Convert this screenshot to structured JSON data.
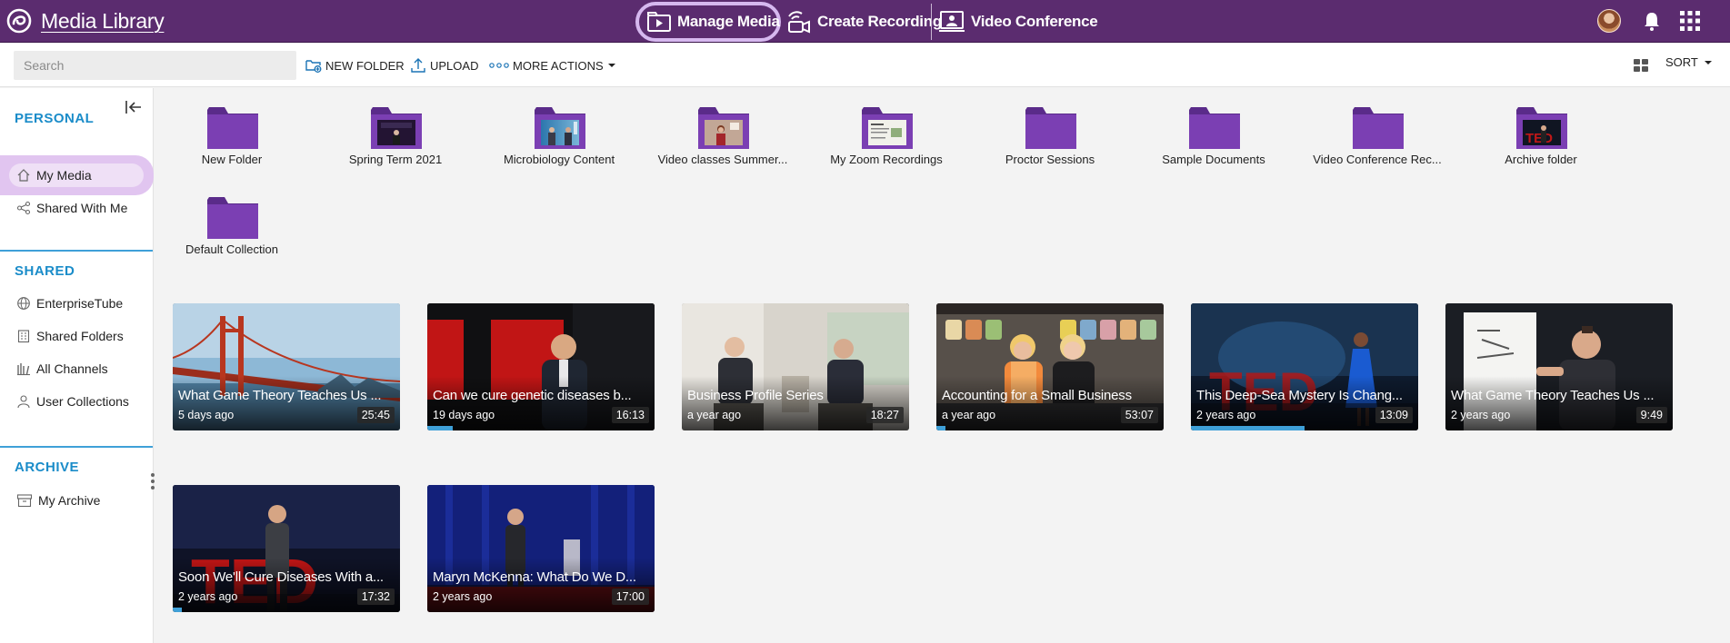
{
  "app": {
    "title": "Media Library"
  },
  "nav": {
    "manage_media": "Manage Media",
    "create_recording": "Create Recording",
    "video_conference": "Video Conference"
  },
  "toolbar": {
    "search_placeholder": "Search",
    "new_folder": "NEW FOLDER",
    "upload": "UPLOAD",
    "more_actions": "MORE ACTIONS",
    "sort": "SORT"
  },
  "sidebar": {
    "personal": {
      "heading": "PERSONAL",
      "items": [
        {
          "label": "My Media",
          "icon": "home-icon",
          "active": true
        },
        {
          "label": "Shared With Me",
          "icon": "share-icon"
        }
      ]
    },
    "shared": {
      "heading": "SHARED",
      "items": [
        {
          "label": "EnterpriseTube",
          "icon": "globe-icon"
        },
        {
          "label": "Shared Folders",
          "icon": "building-icon"
        },
        {
          "label": "All Channels",
          "icon": "channels-icon"
        },
        {
          "label": "User Collections",
          "icon": "user-icon"
        }
      ]
    },
    "archive": {
      "heading": "ARCHIVE",
      "items": [
        {
          "label": "My Archive",
          "icon": "archive-icon"
        }
      ]
    }
  },
  "folders": [
    {
      "label": "New Folder",
      "thumb": "none"
    },
    {
      "label": "Spring Term 2021",
      "thumb": "stage"
    },
    {
      "label": "Microbiology Content",
      "thumb": "interview"
    },
    {
      "label": "Video classes Summer...",
      "thumb": "presenter"
    },
    {
      "label": "My Zoom Recordings",
      "thumb": "slides"
    },
    {
      "label": "Proctor Sessions",
      "thumb": "none"
    },
    {
      "label": "Sample Documents",
      "thumb": "none"
    },
    {
      "label": "Video Conference Rec...",
      "thumb": "none"
    },
    {
      "label": "Archive folder",
      "thumb": "ted"
    },
    {
      "label": "Default Collection",
      "thumb": "none"
    }
  ],
  "videos": [
    {
      "title": "What Game Theory Teaches Us ...",
      "age": "5 days ago",
      "duration": "25:45",
      "scene": "bridge",
      "progress": 0
    },
    {
      "title": "Can we cure genetic diseases b...",
      "age": "19 days ago",
      "duration": "16:13",
      "scene": "ted-man",
      "progress": 0.11
    },
    {
      "title": "Business Profile Series",
      "age": "a year ago",
      "duration": "18:27",
      "scene": "interview",
      "progress": 0
    },
    {
      "title": "Accounting for a Small Business",
      "age": "a year ago",
      "duration": "53:07",
      "scene": "kitchen",
      "progress": 0.04
    },
    {
      "title": "This Deep-Sea Mystery Is Chang...",
      "age": "2 years ago",
      "duration": "13:09",
      "scene": "ted-woman",
      "progress": 0.5
    },
    {
      "title": "What Game Theory Teaches Us ...",
      "age": "2 years ago",
      "duration": "9:49",
      "scene": "whiteboard",
      "progress": 0
    },
    {
      "title": "Soon We'll Cure Diseases With a...",
      "age": "2 years ago",
      "duration": "17:32",
      "scene": "ted-stage",
      "progress": 0.04
    },
    {
      "title": "Maryn McKenna: What Do We D...",
      "age": "2 years ago",
      "duration": "17:00",
      "scene": "blue-stage",
      "progress": 0
    }
  ],
  "colors": {
    "topbar": "#5b2c6f",
    "folder": "#7b3fb3",
    "accent": "#1a8cc9",
    "active_highlight": "#e1c5f0",
    "progress": "#3fa0d8"
  }
}
